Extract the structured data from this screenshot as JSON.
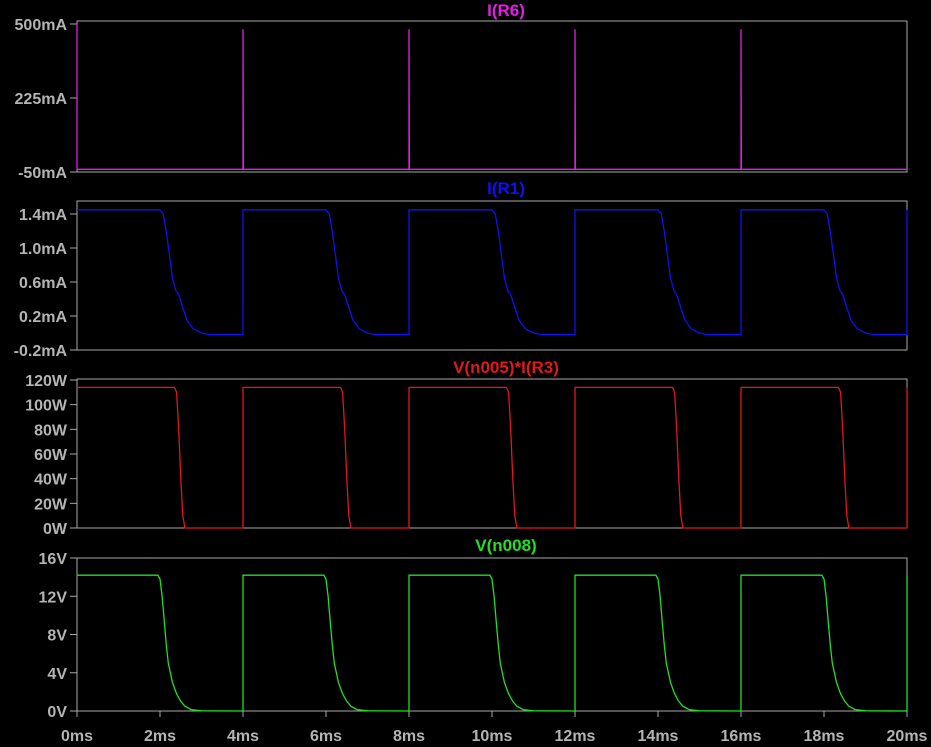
{
  "chart_data": [
    {
      "type": "line",
      "title": "I(R6)",
      "color": "#e020e0",
      "ylim": [
        -50,
        500
      ],
      "yticks": [
        {
          "value": 500,
          "label": "500mA"
        },
        {
          "value": 225,
          "label": "225mA"
        },
        {
          "value": -50,
          "label": "-50mA"
        }
      ],
      "series": [
        {
          "name": "I(R6)",
          "x": [
            0,
            0,
            0.01,
            3.99,
            4,
            4,
            4.01,
            7.99,
            8,
            8,
            8.01,
            11.99,
            12,
            12,
            12.01,
            15.99,
            16,
            16,
            16.01,
            20
          ],
          "y": [
            500,
            -40,
            -40,
            -40,
            -40,
            480,
            -40,
            -40,
            -40,
            480,
            -40,
            -40,
            -40,
            480,
            -40,
            -40,
            -40,
            480,
            -40,
            -40
          ]
        }
      ]
    },
    {
      "type": "line",
      "title": "I(R1)",
      "color": "#1010f0",
      "ylim": [
        -0.2,
        1.6
      ],
      "yticks": [
        {
          "value": 1.4,
          "label": "1.4mA"
        },
        {
          "value": 1.0,
          "label": "1.0mA"
        },
        {
          "value": 0.6,
          "label": "0.6mA"
        },
        {
          "value": 0.2,
          "label": "0.2mA"
        },
        {
          "value": -0.2,
          "label": "-0.2mA"
        }
      ],
      "series": [
        {
          "name": "I(R1)",
          "x": [
            0,
            2.0,
            2.08,
            2.15,
            2.22,
            2.3,
            2.38,
            2.45,
            2.55,
            2.65,
            2.8,
            3.0,
            3.2,
            4.0,
            4.0
          ],
          "y": [
            1.45,
            1.45,
            1.4,
            1.2,
            0.95,
            0.65,
            0.5,
            0.45,
            0.3,
            0.15,
            0.05,
            0.0,
            -0.02,
            -0.02,
            1.45
          ],
          "repeat_every": 4
        }
      ]
    },
    {
      "type": "line",
      "title": "V(n005)*I(R3)",
      "color": "#e01818",
      "ylim": [
        0,
        120
      ],
      "yticks": [
        {
          "value": 120,
          "label": "120W"
        },
        {
          "value": 100,
          "label": "100W"
        },
        {
          "value": 80,
          "label": "80W"
        },
        {
          "value": 60,
          "label": "60W"
        },
        {
          "value": 40,
          "label": "40W"
        },
        {
          "value": 20,
          "label": "20W"
        },
        {
          "value": 0,
          "label": "0W"
        }
      ],
      "series": [
        {
          "name": "V(n005)*I(R3)",
          "x": [
            0,
            2.35,
            2.4,
            2.45,
            2.5,
            2.55,
            2.6,
            4.0,
            4.0
          ],
          "y": [
            114,
            114,
            110,
            80,
            40,
            10,
            0,
            0,
            114
          ],
          "repeat_every": 4
        }
      ]
    },
    {
      "type": "line",
      "title": "V(n008)",
      "color": "#20e020",
      "ylim": [
        0,
        16
      ],
      "yticks": [
        {
          "value": 16,
          "label": "16V"
        },
        {
          "value": 12,
          "label": "12V"
        },
        {
          "value": 8,
          "label": "8V"
        },
        {
          "value": 4,
          "label": "4V"
        },
        {
          "value": 0,
          "label": "0V"
        }
      ],
      "xticks": [
        "0ms",
        "2ms",
        "4ms",
        "6ms",
        "8ms",
        "10ms",
        "12ms",
        "14ms",
        "16ms",
        "18ms",
        "20ms"
      ],
      "xlim": [
        0,
        20
      ],
      "series": [
        {
          "name": "V(n008)",
          "x": [
            0,
            1.95,
            2.0,
            2.05,
            2.1,
            2.15,
            2.2,
            2.3,
            2.4,
            2.5,
            2.6,
            2.75,
            3.0,
            4.0,
            4.0
          ],
          "y": [
            14.2,
            14.2,
            13.8,
            12.0,
            9.5,
            7.0,
            5.0,
            3.0,
            1.8,
            1.0,
            0.5,
            0.15,
            0.02,
            0.0,
            14.2
          ],
          "repeat_every": 4
        }
      ]
    }
  ],
  "colors": {
    "background": "#000000",
    "frame": "#a8a8a8",
    "tick_text": "#b4b4b4"
  }
}
